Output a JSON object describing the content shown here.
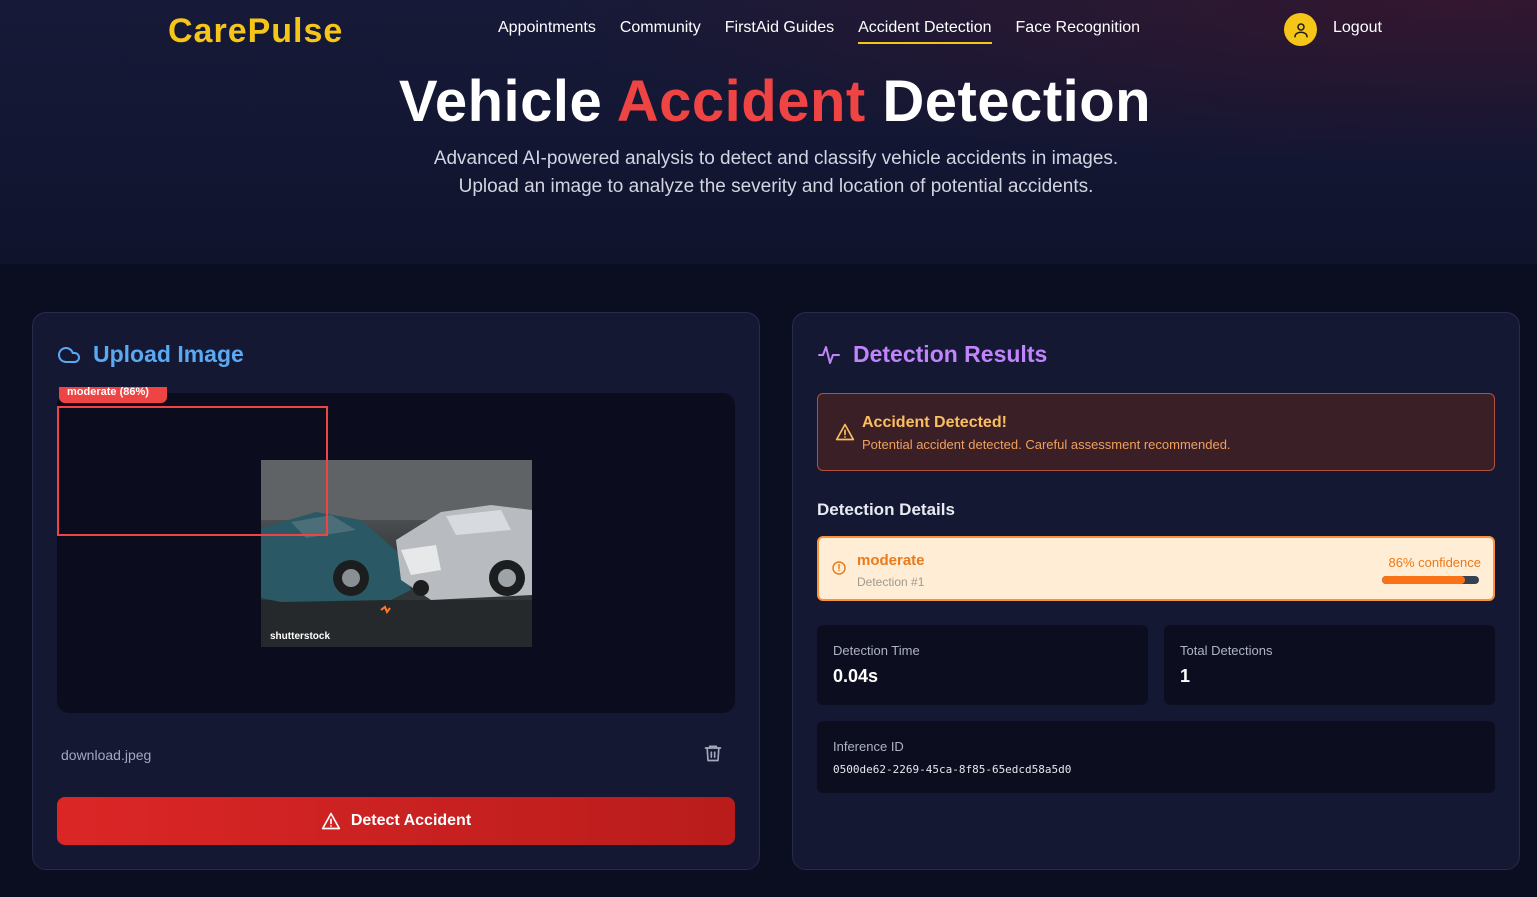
{
  "nav": {
    "logo": "CarePulse",
    "items": [
      {
        "label": "Appointments"
      },
      {
        "label": "Community"
      },
      {
        "label": "FirstAid Guides"
      },
      {
        "label": "Accident Detection",
        "active": true
      },
      {
        "label": "Face Recognition"
      }
    ],
    "logout": "Logout"
  },
  "hero": {
    "title_part1": "Vehicle",
    "title_accent": "Accident",
    "title_part2": "Detection",
    "subtitle_line1": "Advanced AI-powered analysis to detect and classify vehicle accidents in images.",
    "subtitle_line2": "Upload an image to analyze the severity and location of potential accidents."
  },
  "upload": {
    "title": "Upload Image",
    "bbox_label": "moderate (86%)",
    "watermark": "shutterstock",
    "filename": "download.jpeg",
    "detect_button": "Detect Accident"
  },
  "results": {
    "title": "Detection Results",
    "alert_title": "Accident Detected!",
    "alert_text": "Potential accident detected. Careful assessment recommended.",
    "details_heading": "Detection Details",
    "detection": {
      "name": "moderate",
      "number": "Detection #1",
      "confidence_text": "86% confidence",
      "confidence": 0.86
    },
    "stats": {
      "time_label": "Detection Time",
      "time_value": "0.04s",
      "total_label": "Total Detections",
      "total_value": "1"
    },
    "inference_label": "Inference ID",
    "inference_id": "0500de62-2269-45ca-8f85-65edcd58a5d0"
  },
  "colors": {
    "brand": "#f5c518",
    "accent_red": "#ef4444",
    "upload_blue": "#5aa9f2",
    "results_purple": "#c084fc",
    "warning_orange": "#f97316"
  },
  "icons": [
    "user-icon",
    "cloud-icon",
    "activity-icon",
    "warning-triangle-icon",
    "alert-circle-icon",
    "trash-icon"
  ]
}
